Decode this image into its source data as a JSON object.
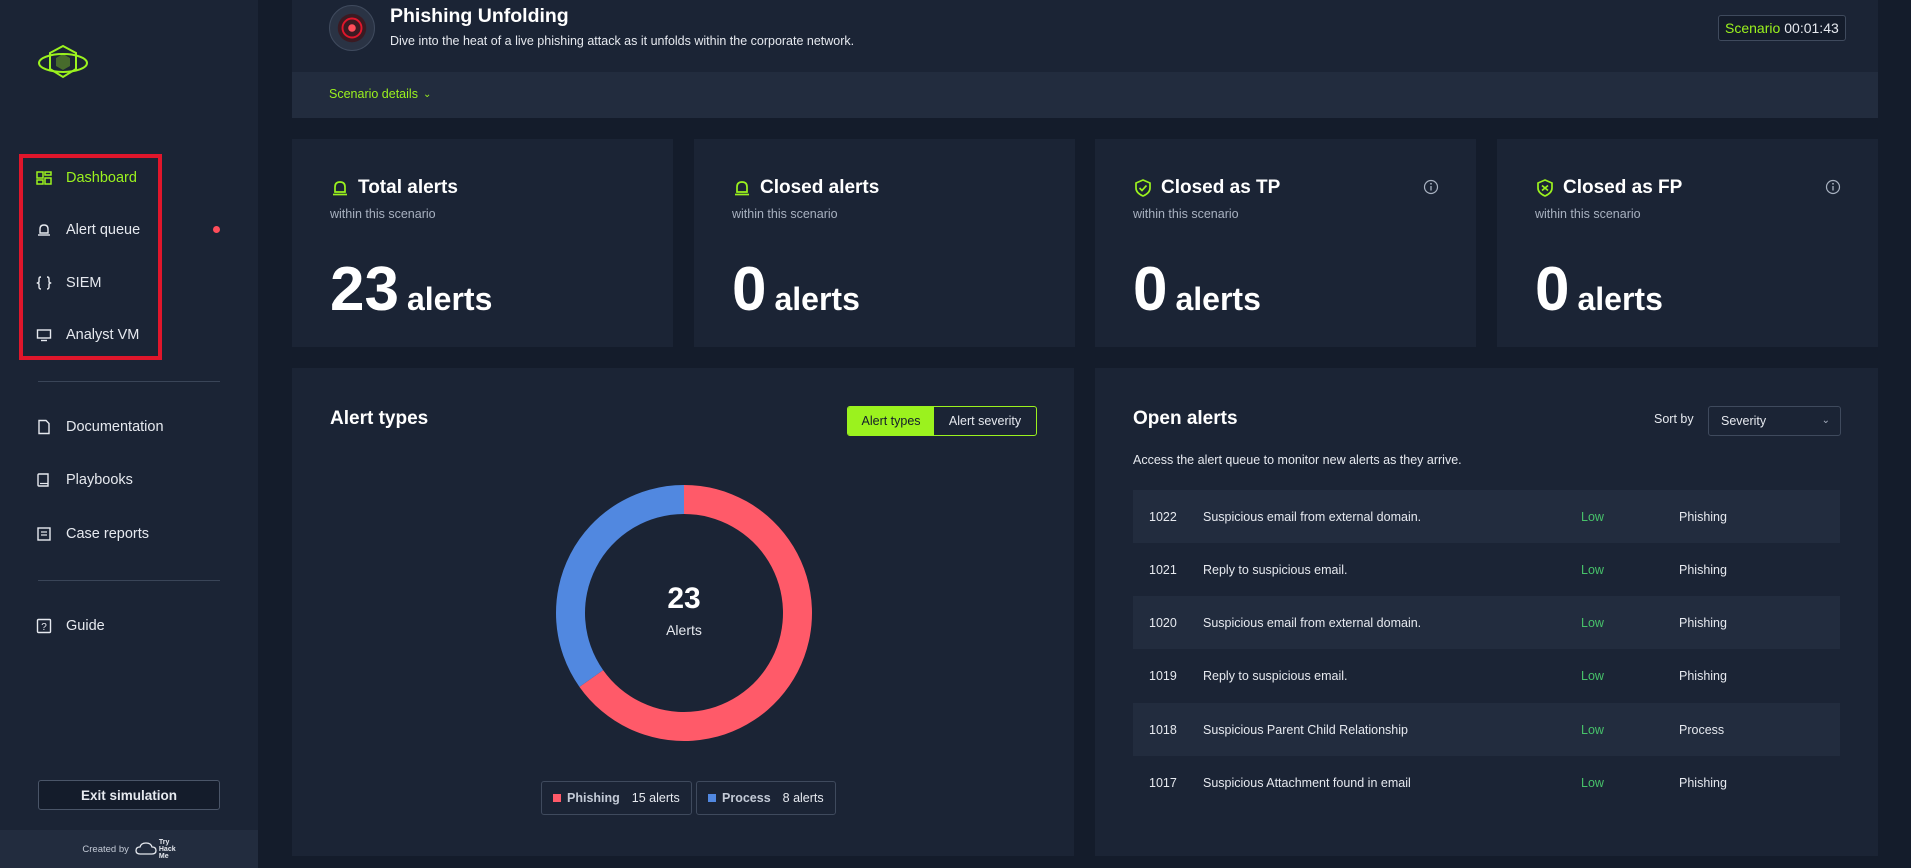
{
  "sidebar": {
    "logo_icon": "tryhackme-soc-logo-icon",
    "items": [
      {
        "label": "Dashboard",
        "icon": "dashboard-icon",
        "active": true
      },
      {
        "label": "Alert queue",
        "icon": "alert-bell-icon",
        "badge": true
      },
      {
        "label": "SIEM",
        "icon": "braces-icon"
      },
      {
        "label": "Analyst VM",
        "icon": "monitor-icon"
      },
      {
        "label": "Documentation",
        "icon": "document-icon"
      },
      {
        "label": "Playbooks",
        "icon": "book-icon"
      },
      {
        "label": "Case reports",
        "icon": "report-icon"
      },
      {
        "label": "Guide",
        "icon": "help-icon"
      }
    ],
    "exit_label": "Exit simulation",
    "created_by": "Created by",
    "brand_lines": [
      "Try",
      "Hack",
      "Me"
    ]
  },
  "header": {
    "title": "Phishing Unfolding",
    "description": "Dive into the heat of a live phishing attack as it unfolds within the corporate network.",
    "details_label": "Scenario details",
    "timer_label": "Scenario",
    "timer_value": "00:01:43"
  },
  "stats": [
    {
      "title": "Total alerts",
      "sub": "within this scenario",
      "value": "23",
      "unit": "alerts",
      "icon": "alert-bell-icon"
    },
    {
      "title": "Closed alerts",
      "sub": "within this scenario",
      "value": "0",
      "unit": "alerts",
      "icon": "alert-bell-icon"
    },
    {
      "title": "Closed as TP",
      "sub": "within this scenario",
      "value": "0",
      "unit": "alerts",
      "icon": "shield-check-icon"
    },
    {
      "title": "Closed as FP",
      "sub": "within this scenario",
      "value": "0",
      "unit": "alerts",
      "icon": "shield-x-icon"
    }
  ],
  "alert_types": {
    "title": "Alert types",
    "toggle_on": "Alert types",
    "toggle_off": "Alert severity",
    "total": "23",
    "total_label": "Alerts",
    "legend": [
      {
        "name": "Phishing",
        "count": "15 alerts",
        "color": "#ff5a69"
      },
      {
        "name": "Process",
        "count": "8 alerts",
        "color": "#5188e0"
      }
    ]
  },
  "chart_data": {
    "type": "pie",
    "categories": [
      "Phishing",
      "Process"
    ],
    "values": [
      15,
      8
    ],
    "colors": [
      "#ff5a69",
      "#5188e0"
    ],
    "center_value": "23",
    "center_label": "Alerts",
    "title": "Alert types"
  },
  "open_alerts": {
    "title": "Open alerts",
    "sort_label": "Sort by",
    "sort_value": "Severity",
    "description": "Access the alert queue to monitor new alerts as they arrive.",
    "rows": [
      {
        "id": "1022",
        "title": "Suspicious email from external domain.",
        "severity": "Low",
        "type": "Phishing"
      },
      {
        "id": "1021",
        "title": "Reply to suspicious email.",
        "severity": "Low",
        "type": "Phishing"
      },
      {
        "id": "1020",
        "title": "Suspicious email from external domain.",
        "severity": "Low",
        "type": "Phishing"
      },
      {
        "id": "1019",
        "title": "Reply to suspicious email.",
        "severity": "Low",
        "type": "Phishing"
      },
      {
        "id": "1018",
        "title": "Suspicious Parent Child Relationship",
        "severity": "Low",
        "type": "Process"
      },
      {
        "id": "1017",
        "title": "Suspicious Attachment found in email",
        "severity": "Low",
        "type": "Phishing"
      }
    ]
  },
  "colors": {
    "accent": "#9bf21e",
    "background": "#141c2b",
    "panel": "#1b2435",
    "severity_low": "#47c26a",
    "highlight_box": "#e0162b",
    "badge": "#ff4d5a"
  }
}
